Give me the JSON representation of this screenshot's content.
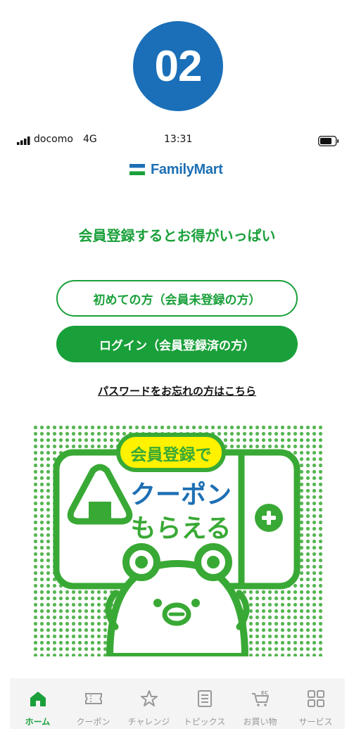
{
  "step_badge": "02",
  "status_bar": {
    "carrier": "docomo",
    "network": "4G",
    "time": "13:31"
  },
  "logo": {
    "text": "FamilyMart"
  },
  "headline": "会員登録するとお得がいっぱい",
  "buttons": {
    "new_member": "初めての方（会員未登録の方）",
    "login": "ログイン（会員登録済の方）"
  },
  "forgot_password": "パスワードをお忘れの方はこちら",
  "banner": {
    "tag": "会員登録で",
    "line1": "クーポン",
    "line2": "もらえる"
  },
  "colors": {
    "brand_green": "#1aa03a",
    "brand_blue": "#1d6fb4",
    "badge_blue": "#1a6fb8",
    "banner_yellow": "#fff200"
  },
  "tabbar": {
    "items": [
      {
        "label": "ホーム",
        "icon": "home-icon",
        "active": true
      },
      {
        "label": "クーポン",
        "icon": "coupon-icon",
        "active": false
      },
      {
        "label": "チャレンジ",
        "icon": "star-icon",
        "active": false
      },
      {
        "label": "トピックス",
        "icon": "document-icon",
        "active": false
      },
      {
        "label": "お買い物",
        "icon": "ec-cart-icon",
        "active": false
      },
      {
        "label": "サービス",
        "icon": "grid-icon",
        "active": false
      }
    ]
  }
}
